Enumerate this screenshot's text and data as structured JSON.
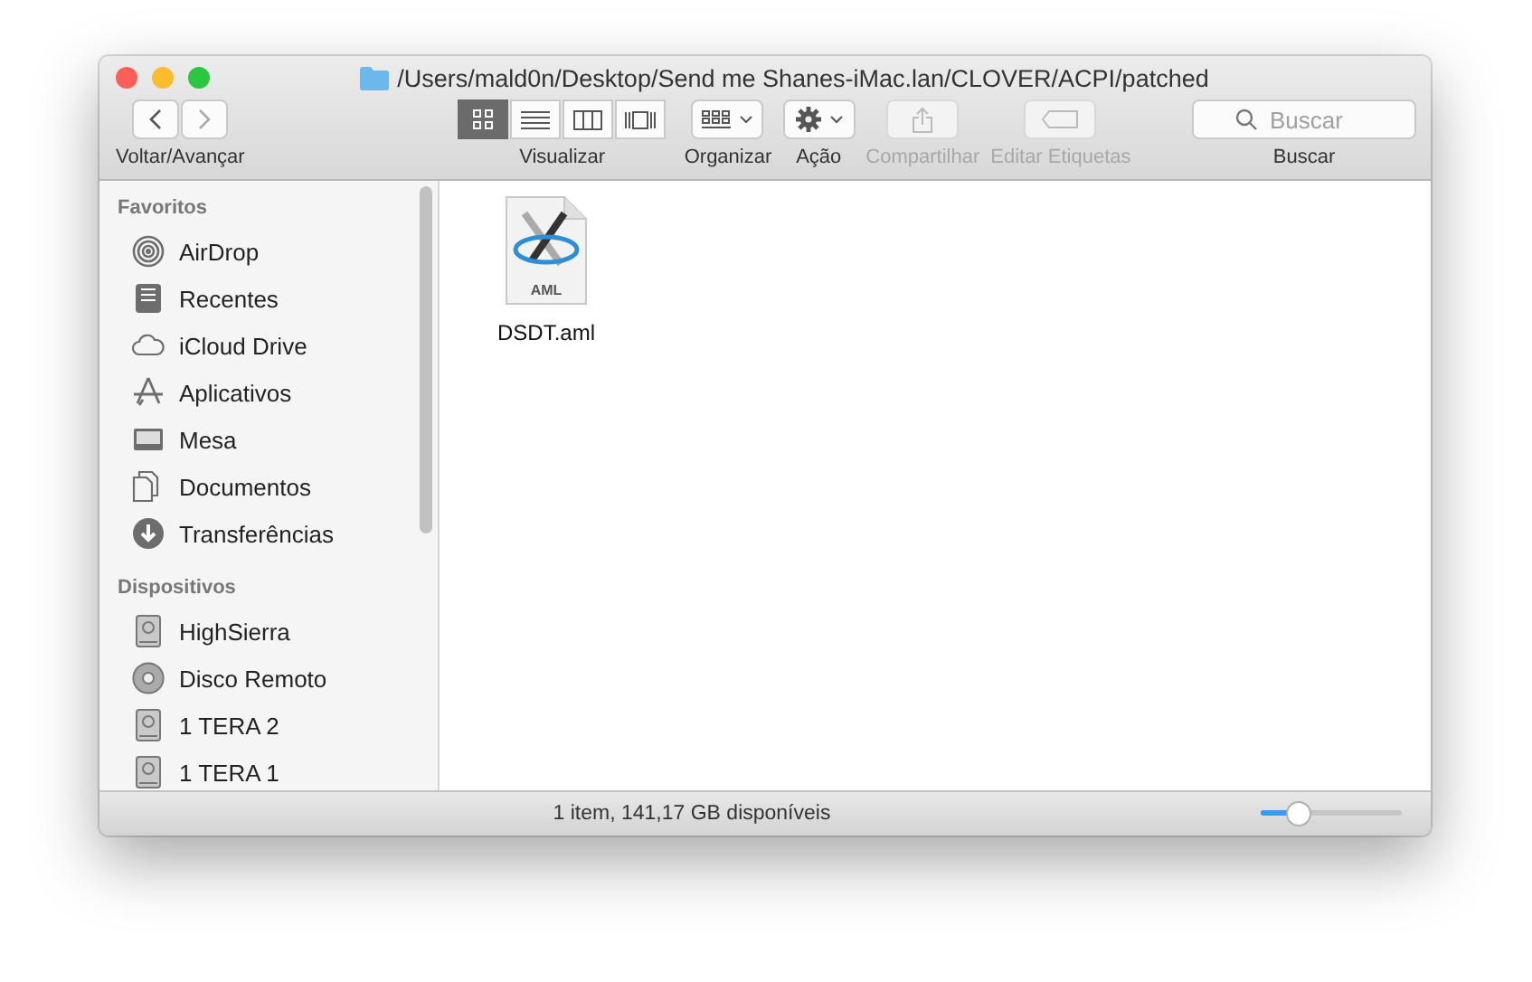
{
  "window": {
    "title": "/Users/mald0n/Desktop/Send me Shanes-iMac.lan/CLOVER/ACPI/patched"
  },
  "toolbar": {
    "nav_label": "Voltar/Avançar",
    "view_modes": [
      {
        "selected": true
      },
      {
        "selected": false
      },
      {
        "selected": false
      },
      {
        "selected": false
      }
    ],
    "view_label": "Visualizar",
    "actions": [
      {
        "label": "Organizar",
        "disabled": false
      },
      {
        "label": "Ação",
        "disabled": false
      },
      {
        "label": "Compartilhar",
        "disabled": true
      },
      {
        "label": "Editar Etiquetas",
        "disabled": true
      }
    ],
    "search": {
      "placeholder": "Buscar",
      "label": "Buscar"
    }
  },
  "sidebar": {
    "sections": [
      {
        "title": "Favoritos",
        "items": [
          {
            "label": "AirDrop"
          },
          {
            "label": "Recentes"
          },
          {
            "label": "iCloud Drive"
          },
          {
            "label": "Aplicativos"
          },
          {
            "label": "Mesa"
          },
          {
            "label": "Documentos"
          },
          {
            "label": "Transferências"
          }
        ]
      },
      {
        "title": "Dispositivos",
        "items": [
          {
            "label": "HighSierra"
          },
          {
            "label": "Disco Remoto"
          },
          {
            "label": "1 TERA 2"
          },
          {
            "label": "1 TERA 1"
          }
        ]
      }
    ]
  },
  "files": [
    {
      "name": "DSDT.aml",
      "badge": "AML"
    }
  ],
  "status_bar": {
    "text": "1 item, 141,17 GB disponíveis",
    "zoom": {
      "level": 0.25
    }
  }
}
